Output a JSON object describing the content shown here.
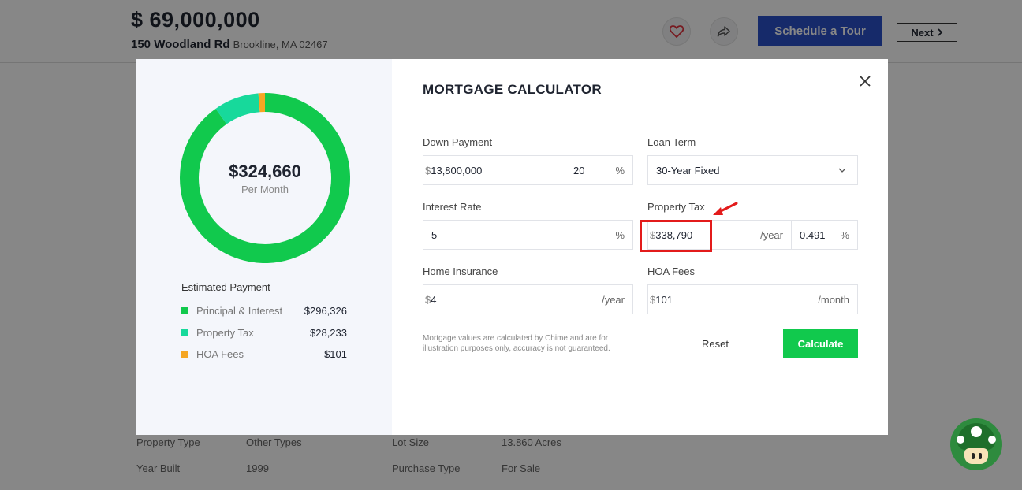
{
  "listing": {
    "price": "$ 69,000,000",
    "street": "150 Woodland Rd",
    "city": "Brookline, MA 02467",
    "tour_label": "Schedule a Tour",
    "next_label": "Next",
    "details": [
      {
        "label": "Property Type",
        "value": "Other Types"
      },
      {
        "label": "Lot Size",
        "value": "13.860 Acres"
      },
      {
        "label": "Year Built",
        "value": "1999"
      },
      {
        "label": "Purchase Type",
        "value": "For Sale"
      }
    ]
  },
  "modal": {
    "title": "MORTGAGE CALCULATOR",
    "monthly": {
      "amount": "$324,660",
      "label": "Per Month"
    },
    "estimated_title": "Estimated Payment",
    "breakdown": [
      {
        "label": "Principal & Interest",
        "value": "$296,326",
        "amount": 296326,
        "color": "#11c94d"
      },
      {
        "label": "Property Tax",
        "value": "$28,233",
        "amount": 28233,
        "color": "#17d99b"
      },
      {
        "label": "HOA Fees",
        "value": "$101",
        "amount": 101,
        "color": "#f5a623"
      }
    ],
    "fields": {
      "down_payment": {
        "label": "Down Payment",
        "prefix": "$",
        "value": "13,800,000",
        "percent": "20",
        "percent_suffix": "%"
      },
      "loan_term": {
        "label": "Loan Term",
        "value": "30-Year Fixed"
      },
      "interest_rate": {
        "label": "Interest Rate",
        "value": "5",
        "suffix": "%"
      },
      "property_tax": {
        "label": "Property Tax",
        "prefix": "$",
        "value": "338,790",
        "suffix": "/year",
        "percent": "0.491",
        "percent_suffix": "%"
      },
      "home_insurance": {
        "label": "Home Insurance",
        "prefix": "$",
        "value": "4",
        "suffix": "/year"
      },
      "hoa_fees": {
        "label": "HOA Fees",
        "prefix": "$",
        "value": "101",
        "suffix": "/month"
      }
    },
    "disclaimer": "Mortgage values are calculated by Chime and are for illustration purposes only, accuracy is not guaranteed.",
    "reset_label": "Reset",
    "calculate_label": "Calculate"
  },
  "colors": {
    "accent_green": "#11c94d",
    "tour_blue": "#2b50c8",
    "highlight_red": "#e31b1b"
  },
  "icons": [
    "heart-icon",
    "share-icon",
    "chevron-right-icon",
    "close-icon",
    "chevron-down-icon",
    "mushroom-icon"
  ]
}
